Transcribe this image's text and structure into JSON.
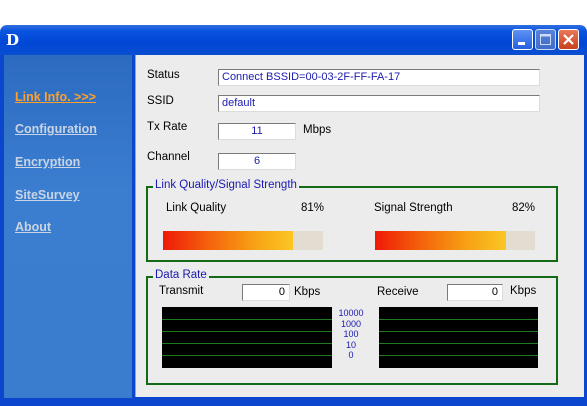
{
  "window": {
    "logo_letter": "D"
  },
  "sidebar": {
    "items": [
      {
        "label": "Link Info. >>>",
        "active": true
      },
      {
        "label": "Configuration",
        "active": false
      },
      {
        "label": "Encryption",
        "active": false
      },
      {
        "label": "SiteSurvey",
        "active": false
      },
      {
        "label": "About",
        "active": false
      }
    ]
  },
  "status": {
    "status_label": "Status",
    "status_value": "Connect BSSID=00-03-2F-FF-FA-17",
    "ssid_label": "SSID",
    "ssid_value": "default",
    "txrate_label": "Tx Rate",
    "txrate_value": "11",
    "txrate_unit": "Mbps",
    "channel_label": "Channel",
    "channel_value": "6"
  },
  "link_quality": {
    "group_title": "Link Quality/Signal Strength",
    "quality_label": "Link Quality",
    "quality_percent": "81%",
    "quality_fraction": 0.81,
    "signal_label": "Signal Strength",
    "signal_percent": "82%",
    "signal_fraction": 0.82
  },
  "data_rate": {
    "group_title": "Data Rate",
    "transmit_label": "Transmit",
    "transmit_value": "0",
    "transmit_unit": "Kbps",
    "receive_label": "Receive",
    "receive_value": "0",
    "receive_unit": "Kbps",
    "scale": [
      "10000",
      "1000",
      "100",
      "10",
      "0"
    ]
  },
  "colors": {
    "active_nav": "#ffa028",
    "group_border": "#156b15",
    "value_text": "#1a1ab0"
  }
}
